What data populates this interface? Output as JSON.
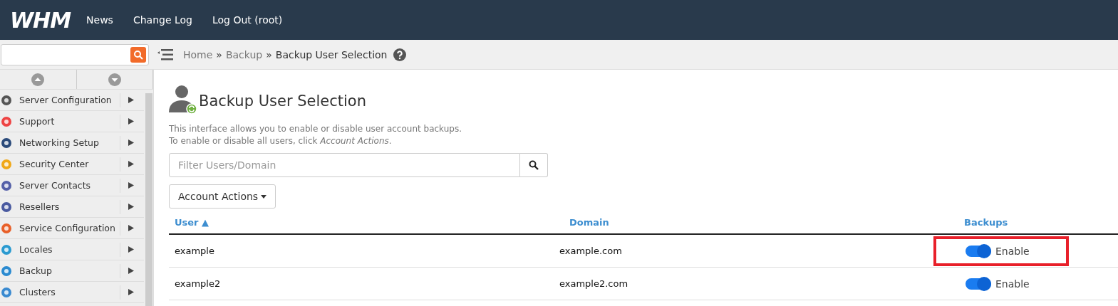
{
  "header": {
    "logo": "WHM",
    "nav": [
      "News",
      "Change Log",
      "Log Out (root)"
    ]
  },
  "sidebar": {
    "items": [
      {
        "label": "Server Configuration"
      },
      {
        "label": "Support"
      },
      {
        "label": "Networking Setup"
      },
      {
        "label": "Security Center"
      },
      {
        "label": "Server Contacts"
      },
      {
        "label": "Resellers"
      },
      {
        "label": "Service Configuration"
      },
      {
        "label": "Locales"
      },
      {
        "label": "Backup"
      },
      {
        "label": "Clusters"
      }
    ]
  },
  "breadcrumb": [
    {
      "label": "Home",
      "current": false
    },
    {
      "label": "Backup",
      "current": false
    },
    {
      "label": "Backup User Selection",
      "current": true
    }
  ],
  "breadcrumb_separator": "»",
  "page": {
    "title": "Backup User Selection",
    "description": [
      "This interface allows you to enable or disable user account backups.",
      "To enable or disable all users, click *Account Actions*."
    ],
    "filter": {
      "placeholder": "Filter Users/Domain"
    },
    "actions_button": "Account Actions"
  },
  "table": {
    "columns": [
      "User ▲",
      "Domain",
      "Backups"
    ],
    "rows": [
      {
        "user": "example",
        "domain": "example.com",
        "backup": {
          "on": true,
          "label": "Enable",
          "highlighted": true
        }
      },
      {
        "user": "example2",
        "domain": "example2.com",
        "backup": {
          "on": true,
          "label": "Enable",
          "highlighted": false
        }
      }
    ]
  }
}
